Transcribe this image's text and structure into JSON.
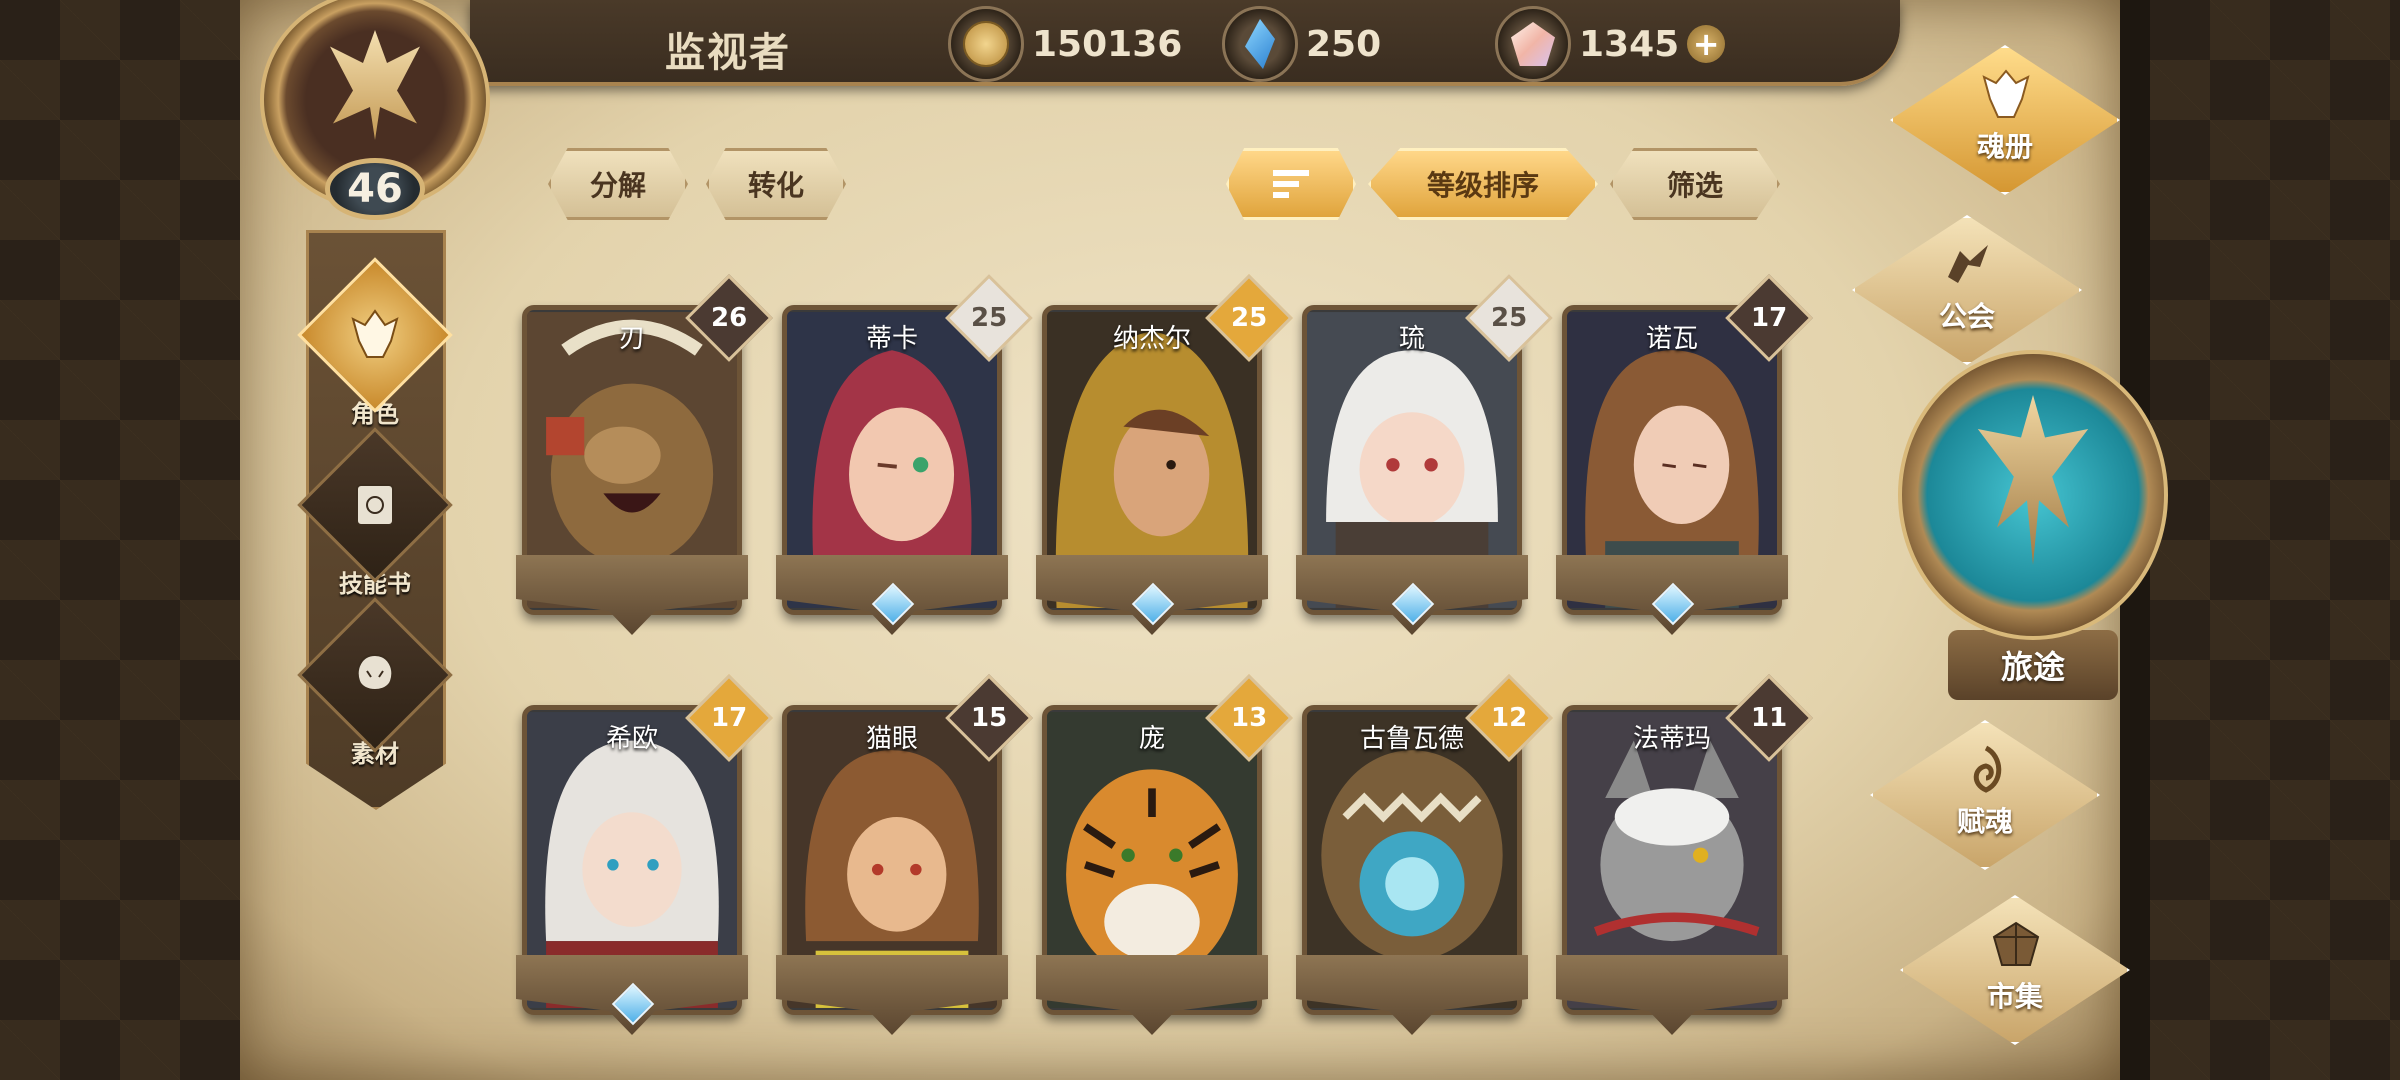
{
  "player": {
    "name": "监视者",
    "level": "46"
  },
  "currencies": {
    "gold": "150136",
    "crystal": "250",
    "gem": "1345",
    "gem_add": "+"
  },
  "left_nav": [
    {
      "label": "角色",
      "icon": "helmet-icon",
      "active": true
    },
    {
      "label": "技能书",
      "icon": "skill-book-icon",
      "active": false
    },
    {
      "label": "素材",
      "icon": "material-icon",
      "active": false
    }
  ],
  "actions": {
    "decompose": "分解",
    "convert": "转化",
    "sort_by_level": "等级排序",
    "filter": "筛选"
  },
  "heroes": [
    {
      "name": "刃",
      "level": "26",
      "badge": "dark",
      "portrait": "bear"
    },
    {
      "name": "蒂卡",
      "level": "25",
      "badge": "silver",
      "portrait": "red-hair"
    },
    {
      "name": "纳杰尔",
      "level": "25",
      "badge": "gold",
      "portrait": "hood"
    },
    {
      "name": "琉",
      "level": "25",
      "badge": "silver",
      "portrait": "white-hair"
    },
    {
      "name": "诺瓦",
      "level": "17",
      "badge": "dark",
      "portrait": "brown-hair"
    },
    {
      "name": "希欧",
      "level": "17",
      "badge": "gold",
      "portrait": "silver-warrior"
    },
    {
      "name": "猫眼",
      "level": "15",
      "badge": "dark",
      "portrait": "cat-girl"
    },
    {
      "name": "庞",
      "level": "13",
      "badge": "gold",
      "portrait": "tiger"
    },
    {
      "name": "古鲁瓦德",
      "level": "12",
      "badge": "gold",
      "portrait": "beast-orb"
    },
    {
      "name": "法蒂玛",
      "level": "11",
      "badge": "dark",
      "portrait": "grey-cat"
    }
  ],
  "right_nav": [
    {
      "label": "魂册",
      "icon": "soul-book-icon",
      "active": true
    },
    {
      "label": "公会",
      "icon": "guild-icon",
      "active": false
    },
    {
      "label": "赋魂",
      "icon": "soul-infuse-icon",
      "active": false
    },
    {
      "label": "市集",
      "icon": "market-icon",
      "active": false
    }
  ],
  "journey": {
    "label": "旅途"
  },
  "colors": {
    "parchment": "#e3d3ac",
    "frame_dark": "#4a3a29",
    "gold_accent": "#e0a43c",
    "badge_dark": "#4b3a32",
    "badge_gold": "#e4a83b",
    "badge_silver": "#e8e3dc",
    "gem_blue": "#4fb0e8"
  }
}
